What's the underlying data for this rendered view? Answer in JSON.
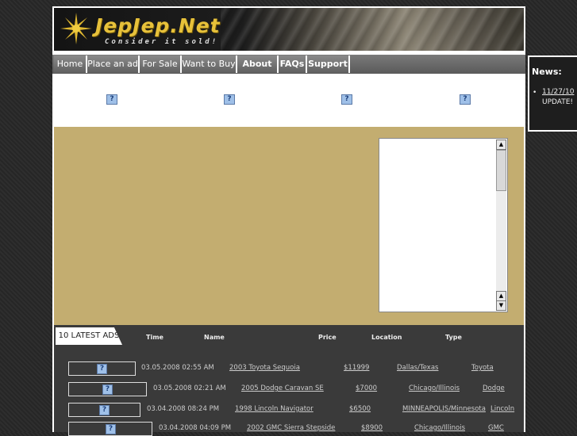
{
  "site": {
    "logo_text": "JepJep.Net",
    "tagline": "Consider it sold!"
  },
  "nav": [
    {
      "label": "Home"
    },
    {
      "label": "Place an ad"
    },
    {
      "label": "For Sale"
    },
    {
      "label": "Want to Buy"
    },
    {
      "label": "About Us"
    },
    {
      "label": "FAQs"
    },
    {
      "label": "Support"
    }
  ],
  "broken_image_glyph": "?",
  "news": {
    "title": "News:",
    "items": [
      {
        "date": "11/27/10",
        "text": "UPDATE!"
      }
    ]
  },
  "latest": {
    "tab_label": "10 LATEST ADS",
    "headers": {
      "time": "Time",
      "name": "Name",
      "price": "Price",
      "location": "Location",
      "type": "Type"
    },
    "rows": [
      {
        "time": "03.05.2008 02:55 AM",
        "name": "2003 Toyota Sequoia",
        "price": "$11999",
        "location": "Dallas/Texas",
        "type": "Toyota"
      },
      {
        "time": "03.05.2008 02:21 AM",
        "name": "2005 Dodge Caravan SE",
        "price": "$7000",
        "location": "Chicago/Illinois",
        "type": "Dodge"
      },
      {
        "time": "03.04.2008 08:24 PM",
        "name": "1998 Lincoln Navigator",
        "price": "$6500",
        "location": "MINNEAPOLIS/Minnesota",
        "type": "Lincoln"
      },
      {
        "time": "03.04.2008 04:09 PM",
        "name": "2002 GMC Sierra Stepside",
        "price": "$8900",
        "location": "Chicago/Illinois",
        "type": "GMC"
      }
    ]
  },
  "colors": {
    "tan_panel": "#c3ad70",
    "logo_gold": "#e7c13a",
    "dark_panel": "#3a3a3a"
  }
}
